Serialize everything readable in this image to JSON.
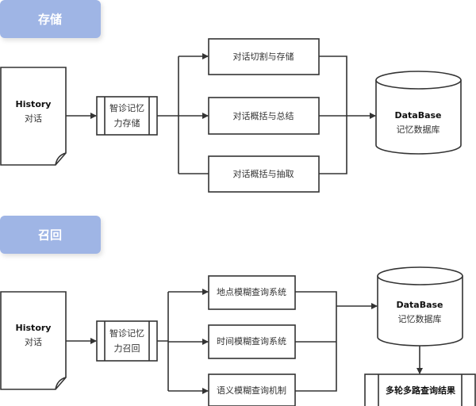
{
  "colors": {
    "section_label_bg": "#9fb5e5",
    "line": "#333333"
  },
  "storage": {
    "section_label": "存储",
    "history": {
      "title": "History",
      "subtitle": "对话"
    },
    "process": {
      "line1": "智诊记忆",
      "line2": "力存储"
    },
    "branches": [
      "对话切割与存储",
      "对话概括与总结",
      "对话概括与抽取"
    ],
    "database": {
      "title": "DataBase",
      "subtitle": "记忆数据库"
    }
  },
  "recall": {
    "section_label": "召回",
    "history": {
      "title": "History",
      "subtitle": "对话"
    },
    "process": {
      "line1": "智诊记忆",
      "line2": "力召回"
    },
    "branches": [
      "地点模糊查询系统",
      "时间模糊查询系统",
      "语义模糊查询机制"
    ],
    "database": {
      "title": "DataBase",
      "subtitle": "记忆数据库"
    },
    "result": "多轮多路查询结果"
  }
}
